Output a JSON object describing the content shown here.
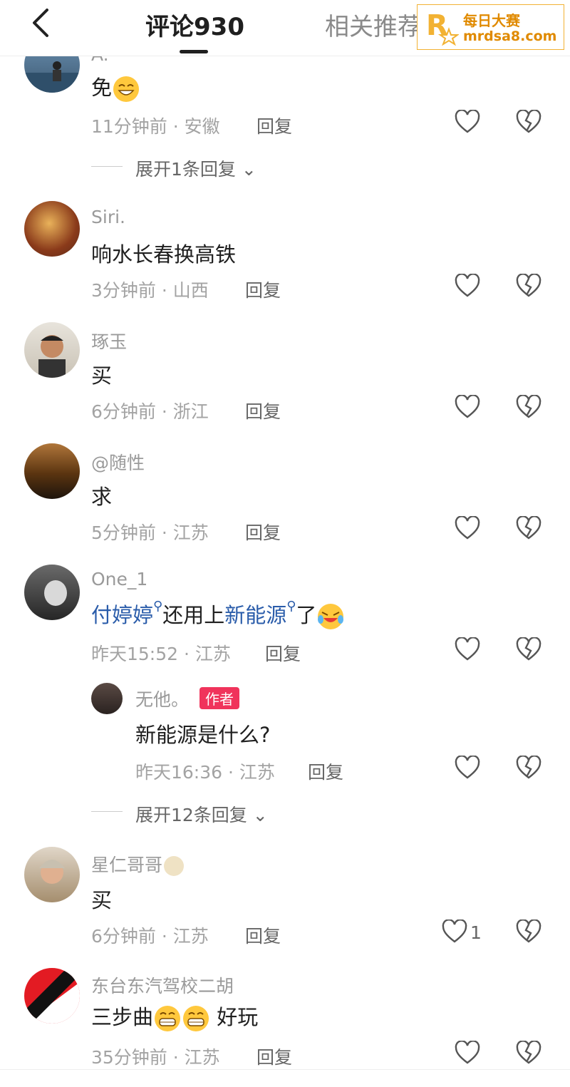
{
  "header": {
    "tab_comments": "评论930",
    "tab_related": "相关推荐",
    "watermark_title": "每日大赛",
    "watermark_url": "mrdsa8.com"
  },
  "comments": [
    {
      "username": "A.",
      "text": "免",
      "time": "11分钟前",
      "location": "安徽",
      "reply": "回复",
      "expand": "展开1条回复"
    },
    {
      "username": "Siri.",
      "text": "响水长春换高铁",
      "time": "3分钟前",
      "location": "山西",
      "reply": "回复"
    },
    {
      "username": "琢玉",
      "text": "买",
      "time": "6分钟前",
      "location": "浙江",
      "reply": "回复"
    },
    {
      "username": "@随性",
      "text": "求",
      "time": "5分钟前",
      "location": "江苏",
      "reply": "回复"
    },
    {
      "username": "One_1",
      "text_link1": "付婷婷",
      "text_mid": "还用上",
      "text_link2": "新能源",
      "text_end": "了",
      "time": "昨天15:52",
      "location": "江苏",
      "reply": "回复"
    },
    {
      "username": "无他。",
      "badge": "作者",
      "text": "新能源是什么?",
      "time": "昨天16:36",
      "location": "江苏",
      "reply": "回复",
      "expand": "展开12条回复"
    },
    {
      "username": "星仁哥哥",
      "text": "买",
      "time": "6分钟前",
      "location": "江苏",
      "reply": "回复",
      "likes": "1"
    },
    {
      "username": "东台东汽驾校二胡",
      "text_start": "三步曲",
      "text_end": "好玩",
      "time": "35分钟前",
      "location": "江苏",
      "reply": "回复"
    }
  ],
  "colors": {
    "link": "#2a5caa",
    "badge": "#f0335b",
    "watermark": "#e08a00"
  }
}
